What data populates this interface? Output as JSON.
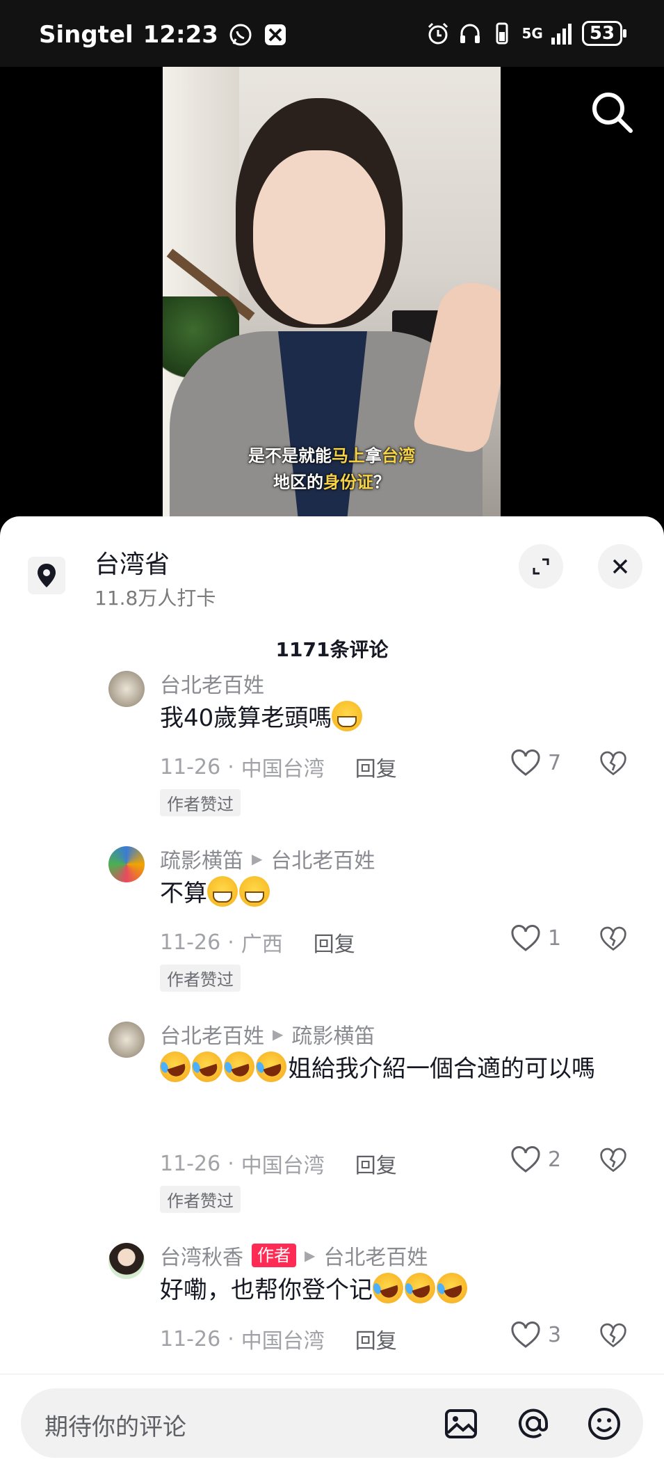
{
  "status_bar": {
    "carrier": "Singtel",
    "time": "12:23",
    "network": "5G",
    "battery": "53"
  },
  "video": {
    "subtitle_line1_a": "是不是就能",
    "subtitle_line1_b": "马上",
    "subtitle_line1_c": "拿",
    "subtitle_line1_d": "台湾",
    "subtitle_line2_a": "地区的",
    "subtitle_line2_b": "身份证",
    "subtitle_line2_c": "？"
  },
  "location": {
    "title": "台湾省",
    "subtitle": "11.8万人打卡"
  },
  "comment_count": "1171条评论",
  "comments": [
    {
      "user": "台北老百姓",
      "reply_to": "",
      "text": "我40歲算老頭嗎",
      "date": "11-26",
      "region": "中国台湾",
      "reply_label": "回复",
      "likes": "7",
      "badge": "作者赞过"
    },
    {
      "user": "疏影横笛",
      "reply_to": "台北老百姓",
      "text": "不算",
      "date": "11-26",
      "region": "广西",
      "reply_label": "回复",
      "likes": "1",
      "badge": "作者赞过"
    },
    {
      "user": "台北老百姓",
      "reply_to": "疏影横笛",
      "text": "姐給我介紹一個合適的可以嗎",
      "date": "11-26",
      "region": "中国台湾",
      "reply_label": "回复",
      "likes": "2",
      "badge": "作者赞过"
    },
    {
      "user": "台湾秋香",
      "author_tag": "作者",
      "reply_to": "台北老百姓",
      "text": "好嘞，也帮你登个记",
      "date": "11-26",
      "region": "中国台湾",
      "reply_label": "回复",
      "likes": "3",
      "badge": ""
    }
  ],
  "input": {
    "placeholder": "期待你的评论"
  },
  "colors": {
    "accent": "#fe2c55",
    "text_primary": "#161823",
    "text_secondary": "#8a8b91"
  }
}
